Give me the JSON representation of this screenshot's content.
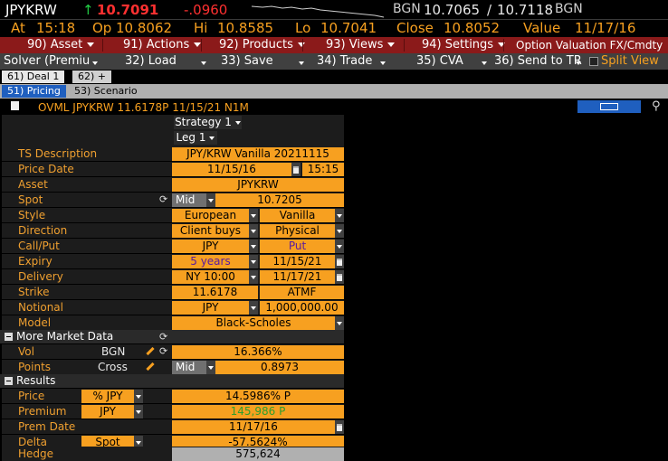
{
  "ticker": {
    "symbol": "JPYKRW",
    "arrow": "↑",
    "last": "10.7091",
    "change": "-.0960",
    "source": "BGN",
    "bid": "10.7065",
    "ask": "10.7118",
    "source2": "BGN",
    "at_label": "At",
    "time": "15:18",
    "op_label": "Op",
    "open": "10.8062",
    "hi_label": "Hi",
    "high": "10.8585",
    "lo_label": "Lo",
    "low": "10.7041",
    "close_label": "Close",
    "close": "10.8052",
    "value_label": "Value",
    "value_date": "11/17/16"
  },
  "menu": {
    "asset": "90) Asset",
    "actions": "91) Actions",
    "products": "92) Products",
    "views": "93) Views",
    "settings": "94) Settings",
    "title": "Option Valuation FX/Cmdty"
  },
  "toolbar": {
    "solver": "Solver (Premiu",
    "load": "32) Load",
    "save": "33) Save",
    "trade": "34) Trade",
    "cva": "35) CVA",
    "send": "36) Send to TR",
    "split": "Split View"
  },
  "tabs": {
    "deal1": "61) Deal 1",
    "plus": "62) +",
    "pricing": "51) Pricing",
    "scenario": "53) Scenario"
  },
  "deal": {
    "title": "OVML JPYKRW 11.6178P 11/15/21 N1M",
    "strategy": "Strategy 1",
    "leg": "Leg 1"
  },
  "fields": {
    "ts_desc_label": "TS Description",
    "ts_desc": "JPY/KRW Vanilla 20211115",
    "price_date_label": "Price Date",
    "price_date": "11/15/16",
    "price_time": "15:15",
    "asset_label": "Asset",
    "asset": "JPYKRW",
    "spot_label": "Spot",
    "spot_side": "Mid",
    "spot": "10.7205",
    "style_label": "Style",
    "style1": "European",
    "style2": "Vanilla",
    "direction_label": "Direction",
    "direction1": "Client buys",
    "direction2": "Physical",
    "callput_label": "Call/Put",
    "callput1": "JPY",
    "callput2": "Put",
    "expiry_label": "Expiry",
    "expiry1": "5 years",
    "expiry2": "11/15/21",
    "delivery_label": "Delivery",
    "delivery1": "NY 10:00",
    "delivery2": "11/17/21",
    "strike_label": "Strike",
    "strike1": "11.6178",
    "strike2": "ATMF",
    "notional_label": "Notional",
    "notional1": "JPY",
    "notional2": "1,000,000.00",
    "model_label": "Model",
    "model": "Black-Scholes"
  },
  "market": {
    "section": "More Market Data",
    "vol_label": "Vol",
    "vol_src": "BGN",
    "vol": "16.366%",
    "points_label": "Points",
    "points_src": "Cross",
    "points_side": "Mid",
    "points": "0.8973"
  },
  "results": {
    "section": "Results",
    "price_label": "Price",
    "price_unit": "% JPY",
    "price": "14.5986% P",
    "premium_label": "Premium",
    "premium_unit": "JPY",
    "premium": "145,986 P",
    "prem_date_label": "Prem Date",
    "prem_date": "11/17/16",
    "delta_label": "Delta",
    "delta_unit": "Spot",
    "delta": "-57.5624%",
    "hedge_label": "Hedge",
    "hedge": "575,624"
  },
  "colors": {
    "accent_orange": "#f7a020",
    "menu_red": "#8b1a1a",
    "ticker_red": "#ff3030",
    "ticker_green": "#22cc44",
    "premium_green": "#2e9e2e"
  }
}
